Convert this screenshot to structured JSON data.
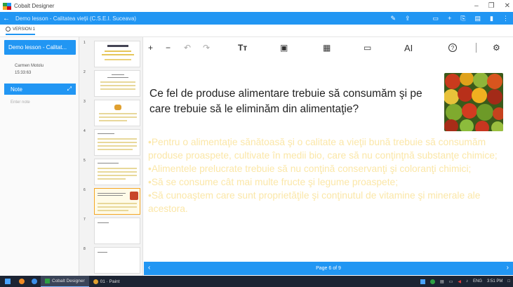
{
  "window": {
    "app_title": "Cobalt Designer",
    "controls": {
      "minimize": "–",
      "restore": "❐",
      "close": "✕"
    }
  },
  "appbar": {
    "back_icon": "←",
    "doc_title": "Demo lesson - Calitatea vieții (C.S.E.I. Suceava)"
  },
  "tabs": {
    "version_label": "VERSION 1"
  },
  "sidebar": {
    "lesson_title": "Demo lesson - Calitat...",
    "author": "Carmen Motolu",
    "time": "15:33:63",
    "note_label": "Note",
    "note_expand_icon": "⤢",
    "note_placeholder": "Enter note"
  },
  "thumbnails": {
    "numbers": [
      "1",
      "2",
      "3",
      "4",
      "5",
      "6",
      "7",
      "8"
    ],
    "active_index": 6
  },
  "toolbar": {
    "add": "+",
    "remove": "−",
    "undo": "↶",
    "redo": "↷",
    "text": "Tт",
    "image": "▣",
    "video": "▦",
    "layout": "▭",
    "font": "AΙ",
    "help": "?",
    "settings": "⚙"
  },
  "slide": {
    "heading": "Ce fel de produse alimentare trebuie să consumăm şi pe care trebuie să le eliminăm din alimentaţie?",
    "bullets": [
      "•Pentru o alimentaţie sănătoasă şi o calitate a vieţii bună  trebuie să consumăm produse proaspete, cultivate în medii bio, care să nu conţinţnă substanţe chimice;",
      "•Alimentele prelucrate trebuie să nu conţină conservanţi şi coloranţi chimici;",
      "•Să se consume cât mai multe fructe şi legume proaspete;",
      "•Să cunoaştem care sunt proprietăţile şi conţinutul de vitamine şi minerale ale acestora."
    ]
  },
  "pager": {
    "prev_icon": "‹",
    "next_icon": "›",
    "label": "Page 6 of 9"
  },
  "taskbar": {
    "apps": [
      {
        "label": "Cobalt Designer",
        "active": true
      },
      {
        "label": "01 · Paint",
        "active": false
      }
    ],
    "tray": {
      "language": "ENG",
      "time": "3:51 PM"
    }
  },
  "colors": {
    "accent": "#2196f3",
    "bullet_text": "#fbe7a8",
    "taskbar": "#1c2433"
  }
}
